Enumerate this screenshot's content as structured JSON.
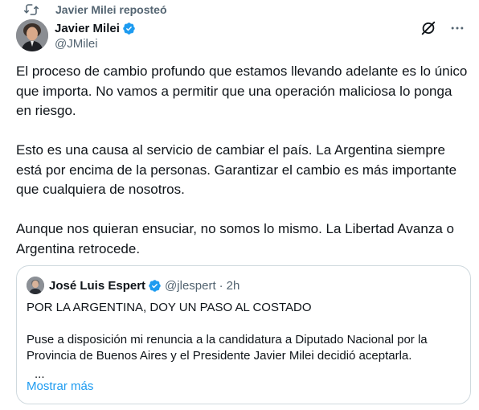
{
  "repost": {
    "label": "Javier Milei reposteó"
  },
  "author": {
    "name": "Javier Milei",
    "handle": "@JMilei"
  },
  "tweet": {
    "paragraphs": [
      "El proceso de cambio profundo que estamos llevando adelante es lo único que importa. No vamos a permitir que una operación maliciosa lo ponga en riesgo.",
      "Esto es una causa al servicio de cambiar el país. La Argentina siempre está por encima de la personas. Garantizar el cambio es más importante que cualquiera de nosotros.",
      "Aunque nos quieran ensuciar, no somos lo mismo. La Libertad Avanza o Argentina retrocede."
    ]
  },
  "quote": {
    "name": "José Luis Espert",
    "handle": "@jlespert",
    "separator": "·",
    "time": "2h",
    "line1": "POR LA ARGENTINA, DOY UN PASO AL COSTADO",
    "line2": "Puse a disposición mi renuncia a la candidatura a Diputado Nacional por la Provincia de Buenos Aires y el Presidente Javier Milei decidió aceptarla.",
    "ellipsis": "...",
    "show_more": "Mostrar más"
  },
  "colors": {
    "text": "#0f1419",
    "secondary": "#536471",
    "link": "#1d9bf0",
    "verified": "#1d9bf0",
    "border": "#cfd9de"
  },
  "icons": {
    "repost": "repost-icon",
    "verified": "verified-badge-icon",
    "grok": "grok-icon",
    "more": "more-dots-icon"
  }
}
